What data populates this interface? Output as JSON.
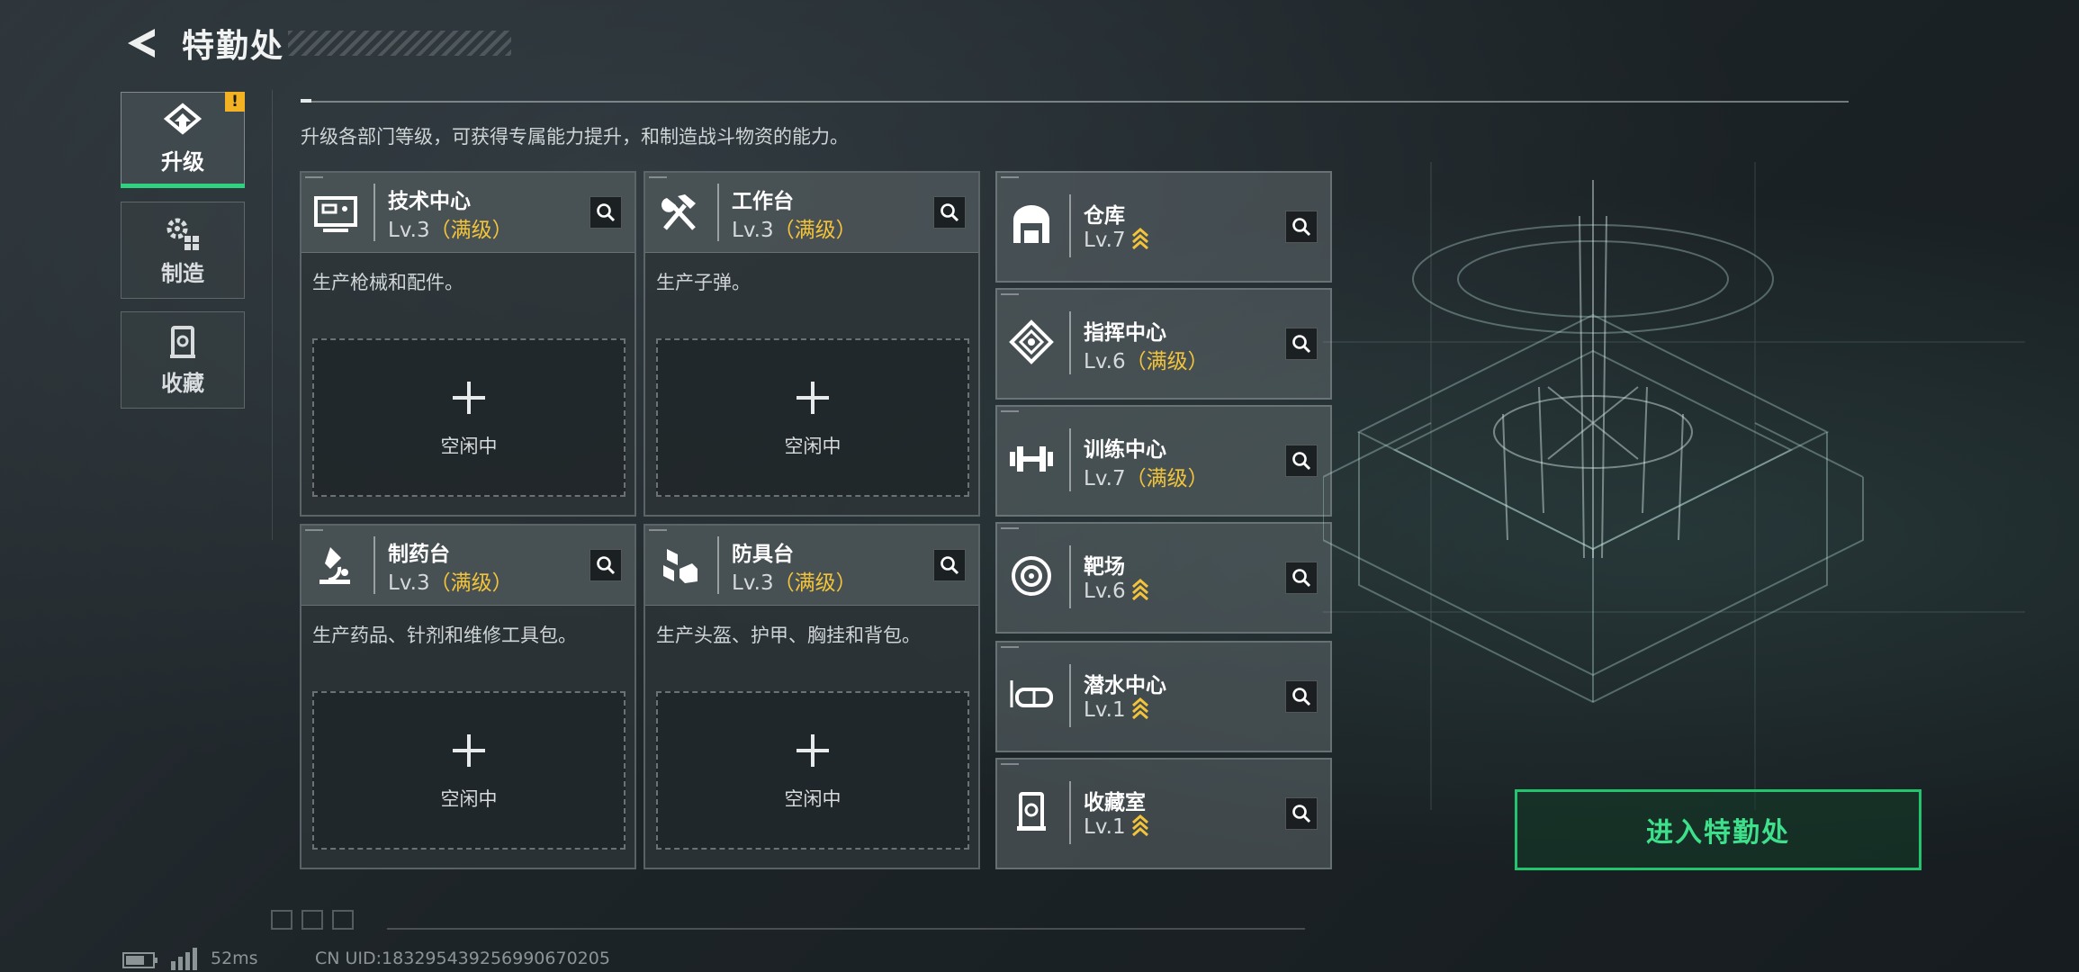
{
  "header": {
    "title": "特勤处",
    "back_icon": "back-arrow-icon"
  },
  "sidebar": {
    "tabs": [
      {
        "label": "升级",
        "icon": "upgrade-icon",
        "active": true,
        "badge": "!"
      },
      {
        "label": "制造",
        "icon": "gears-icon",
        "active": false
      },
      {
        "label": "收藏",
        "icon": "collection-icon",
        "active": false
      }
    ]
  },
  "description": "升级各部门等级，可获得专属能力提升，和制造战斗物资的能力。",
  "workshops": [
    {
      "name": "技术中心",
      "level": "Lv.3",
      "max": "（满级）",
      "desc": "生产枪械和配件。",
      "slot": "空闲中",
      "icon": "tech-center-icon"
    },
    {
      "name": "工作台",
      "level": "Lv.3",
      "max": "（满级）",
      "desc": "生产子弹。",
      "slot": "空闲中",
      "icon": "workbench-icon"
    },
    {
      "name": "制药台",
      "level": "Lv.3",
      "max": "（满级）",
      "desc": "生产药品、针剂和维修工具包。",
      "slot": "空闲中",
      "icon": "pharmacy-icon"
    },
    {
      "name": "防具台",
      "level": "Lv.3",
      "max": "（满级）",
      "desc": "生产头盔、护甲、胸挂和背包。",
      "slot": "空闲中",
      "icon": "armor-bench-icon"
    }
  ],
  "facilities": [
    {
      "name": "仓库",
      "level": "Lv.7",
      "max": "",
      "upgradable": true,
      "icon": "warehouse-icon"
    },
    {
      "name": "指挥中心",
      "level": "Lv.6",
      "max": "（满级）",
      "upgradable": false,
      "icon": "command-center-icon"
    },
    {
      "name": "训练中心",
      "level": "Lv.7",
      "max": "（满级）",
      "upgradable": false,
      "icon": "dumbbell-icon"
    },
    {
      "name": "靶场",
      "level": "Lv.6",
      "max": "",
      "upgradable": true,
      "icon": "target-icon"
    },
    {
      "name": "潜水中心",
      "level": "Lv.1",
      "max": "",
      "upgradable": true,
      "icon": "dive-mask-icon"
    },
    {
      "name": "收藏室",
      "level": "Lv.1",
      "max": "",
      "upgradable": true,
      "icon": "collection-room-icon"
    }
  ],
  "enter_button": "进入特勤处",
  "status_bar": {
    "ping": "52ms",
    "uid": "CN UID:183295439256990670205"
  },
  "colors": {
    "accent": "#2fd27f",
    "max_level": "#f3c43a",
    "warning": "#f2b224"
  }
}
